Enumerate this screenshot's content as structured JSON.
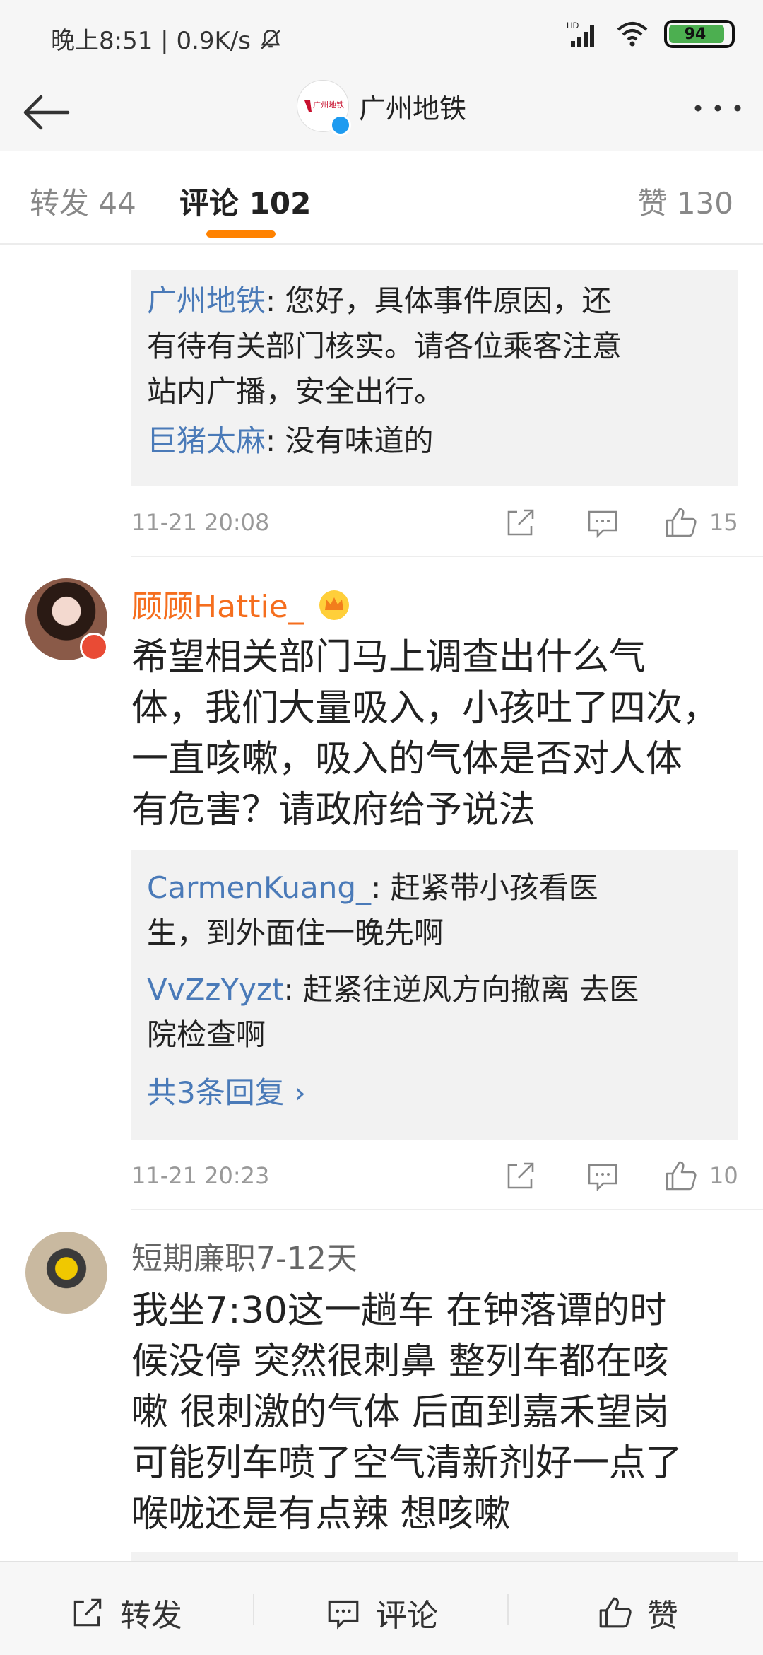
{
  "status_bar": {
    "time": "晚上8:51",
    "network_speed": "0.9K/s",
    "battery": "94",
    "signal_label": "HD"
  },
  "header": {
    "title": "广州地铁",
    "logo_text": "广州地铁"
  },
  "tabs": {
    "reposts": "转发 44",
    "comments": "评论 102",
    "likes": "赞 130"
  },
  "thread1": {
    "replies": [
      {
        "user": "广州地铁",
        "text": ": 您好，具体事件原因，还"
      },
      {
        "user": "",
        "text": "有待有关部门核实。请各位乘客注意"
      },
      {
        "user": "",
        "text": "站内广播，安全出行。"
      },
      {
        "user": "巨猪太麻",
        "text": ": 没有味道的"
      }
    ],
    "time": "11-21 20:08",
    "likes": "15"
  },
  "comment2": {
    "user": "顾顾Hattie_",
    "lines": [
      "希望相关部门马上调查出什么气",
      "体，我们大量吸入，小孩吐了四次，",
      "一直咳嗽，吸入的气体是否对人体",
      "有危害？请政府给予说法"
    ],
    "replies": [
      {
        "user": "CarmenKuang_",
        "text": ": 赶紧带小孩看医"
      },
      {
        "user": "",
        "text": "生，到外面住一晚先啊"
      },
      {
        "user": "VvZzYyzt",
        "text": ": 赶紧往逆风方向撤离 去医"
      },
      {
        "user": "",
        "text": "院检查啊"
      }
    ],
    "more_replies": "共3条回复 ›",
    "time": "11-21 20:23",
    "likes": "10"
  },
  "comment3": {
    "user": "短期廉职7-12天",
    "lines": [
      "我坐7:30这一趟车  在钟落谭的时",
      "候没停 突然很刺鼻 整列车都在咳",
      "嗽 很刺激的气体 后面到嘉禾望岗",
      "可能列车喷了空气清新剂好一点了",
      "喉咙还是有点辣 想咳嗽"
    ]
  },
  "bottom_bar": {
    "repost": "转发",
    "comment": "评论",
    "like": "赞"
  },
  "colors": {
    "accent": "#ff8200",
    "username_link": "#4a7ab8",
    "vip_name": "#f56e1e"
  }
}
